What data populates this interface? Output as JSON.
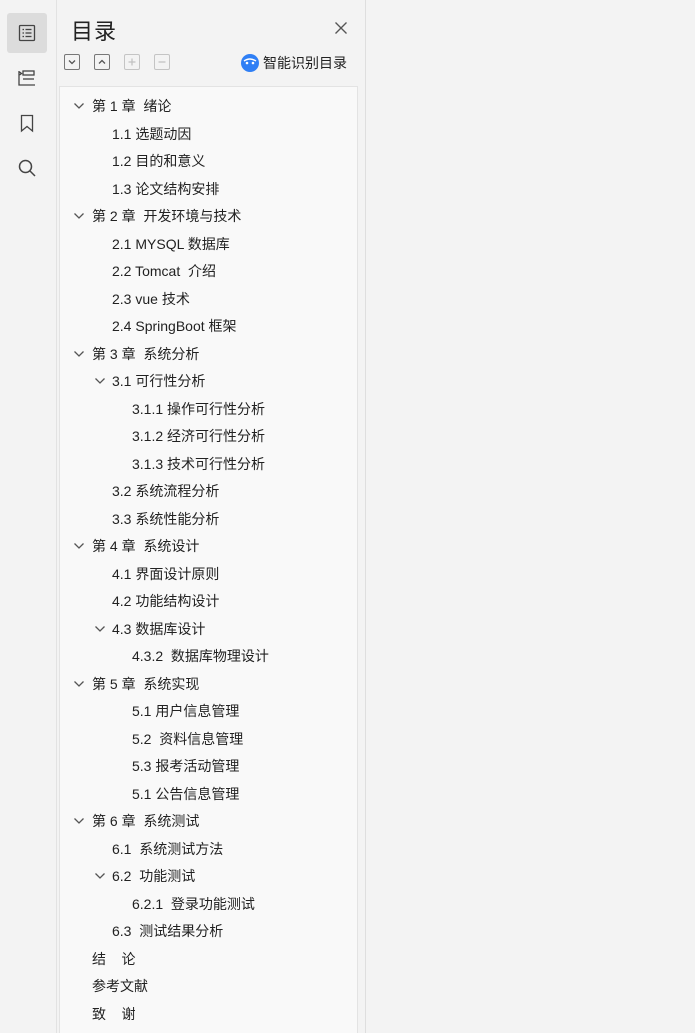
{
  "panel": {
    "title": "目录",
    "smart_toc_label": "智能识别目录"
  },
  "colors": {
    "accent": "#2f7ff5",
    "rail_active": "#dcdcdc",
    "panel_bg": "#f3f3f3",
    "tree_bg": "#f9f9f9"
  },
  "rail_icons": [
    "toc-icon",
    "outline-icon",
    "bookmark-icon",
    "search-icon"
  ],
  "toc": [
    {
      "label": "第 1 章  绪论",
      "level": 0,
      "expanded": true
    },
    {
      "label": "1.1 选题动因",
      "level": 1
    },
    {
      "label": "1.2 目的和意义",
      "level": 1
    },
    {
      "label": "1.3 论文结构安排",
      "level": 1
    },
    {
      "label": "第 2 章  开发环境与技术",
      "level": 0,
      "expanded": true
    },
    {
      "label": "2.1 MYSQL 数据库",
      "level": 1
    },
    {
      "label": "2.2 Tomcat  介绍",
      "level": 1
    },
    {
      "label": "2.3 vue 技术",
      "level": 1
    },
    {
      "label": "2.4 SpringBoot 框架",
      "level": 1
    },
    {
      "label": "第 3 章  系统分析",
      "level": 0,
      "expanded": true
    },
    {
      "label": "3.1 可行性分析",
      "level": 1,
      "expanded": true
    },
    {
      "label": "3.1.1 操作可行性分析",
      "level": 2
    },
    {
      "label": "3.1.2 经济可行性分析",
      "level": 2
    },
    {
      "label": "3.1.3 技术可行性分析",
      "level": 2
    },
    {
      "label": "3.2 系统流程分析",
      "level": 1
    },
    {
      "label": "3.3 系统性能分析",
      "level": 1
    },
    {
      "label": "第 4 章  系统设计",
      "level": 0,
      "expanded": true
    },
    {
      "label": "4.1 界面设计原则",
      "level": 1
    },
    {
      "label": "4.2 功能结构设计",
      "level": 1
    },
    {
      "label": "4.3 数据库设计",
      "level": 1,
      "expanded": true
    },
    {
      "label": "4.3.2  数据库物理设计",
      "level": 2
    },
    {
      "label": "第 5 章  系统实现",
      "level": 0,
      "expanded": true
    },
    {
      "label": "5.1 用户信息管理",
      "level": 2
    },
    {
      "label": "5.2  资料信息管理",
      "level": 2
    },
    {
      "label": "5.3 报考活动管理",
      "level": 2
    },
    {
      "label": "5.1 公告信息管理",
      "level": 2
    },
    {
      "label": "第 6 章  系统测试",
      "level": 0,
      "expanded": true
    },
    {
      "label": "6.1  系统测试方法",
      "level": 1
    },
    {
      "label": "6.2  功能测试",
      "level": 1,
      "expanded": true
    },
    {
      "label": "6.2.1  登录功能测试",
      "level": 2
    },
    {
      "label": "6.3  测试结果分析",
      "level": 1
    },
    {
      "label": "结    论",
      "level": 0
    },
    {
      "label": "参考文献",
      "level": 0
    },
    {
      "label": "致    谢",
      "level": 0
    }
  ]
}
